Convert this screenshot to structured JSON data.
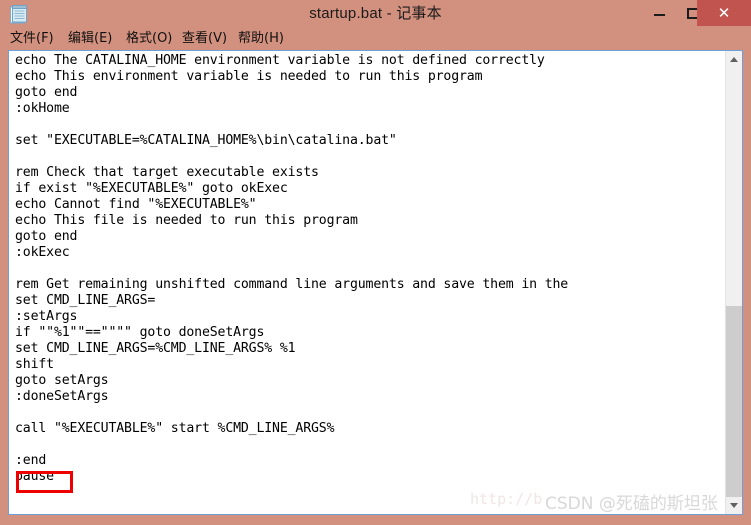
{
  "window": {
    "title": "startup.bat - 记事本",
    "icon": "notepad-icon",
    "frame_color": "#d2907e",
    "close_button_color": "#c25450",
    "controls": {
      "minimize": "−",
      "maximize": "□",
      "close": "✕"
    }
  },
  "menubar": {
    "items": [
      {
        "label": "文件(F)"
      },
      {
        "label": "编辑(E)"
      },
      {
        "label": "格式(O)"
      },
      {
        "label": "查看(V)"
      },
      {
        "label": "帮助(H)"
      }
    ]
  },
  "editor": {
    "content": "echo The CATALINA_HOME environment variable is not defined correctly\necho This environment variable is needed to run this program\ngoto end\n:okHome\n\nset \"EXECUTABLE=%CATALINA_HOME%\\bin\\catalina.bat\"\n\nrem Check that target executable exists\nif exist \"%EXECUTABLE%\" goto okExec\necho Cannot find \"%EXECUTABLE%\"\necho This file is needed to run this program\ngoto end\n:okExec\n\nrem Get remaining unshifted command line arguments and save them in the\nset CMD_LINE_ARGS=\n:setArgs\nif \"\"%1\"\"==\"\"\"\" goto doneSetArgs\nset CMD_LINE_ARGS=%CMD_LINE_ARGS% %1\nshift\ngoto setArgs\n:doneSetArgs\n\ncall \"%EXECUTABLE%\" start %CMD_LINE_ARGS%\n\n:end\npause",
    "lines": [
      "echo The CATALINA_HOME environment variable is not defined correctly",
      "echo This environment variable is needed to run this program",
      "goto end",
      ":okHome",
      "",
      "set \"EXECUTABLE=%CATALINA_HOME%\\bin\\catalina.bat\"",
      "",
      "rem Check that target executable exists",
      "if exist \"%EXECUTABLE%\" goto okExec",
      "echo Cannot find \"%EXECUTABLE%\"",
      "echo This file is needed to run this program",
      "goto end",
      ":okExec",
      "",
      "rem Get remaining unshifted command line arguments and save them in the",
      "set CMD_LINE_ARGS=",
      ":setArgs",
      "if \"\"%1\"\"==\"\"\"\" goto doneSetArgs",
      "set CMD_LINE_ARGS=%CMD_LINE_ARGS% %1",
      "shift",
      "goto setArgs",
      ":doneSetArgs",
      "",
      "call \"%EXECUTABLE%\" start %CMD_LINE_ARGS%",
      "",
      ":end",
      "pause"
    ],
    "highlight": {
      "target_text": "pause",
      "color": "#ee0000"
    }
  },
  "scrollbar": {
    "up_arrow": "▲",
    "down_arrow": "▼",
    "thumb_color": "#cdcdcd",
    "track_color": "#f0f0f0"
  },
  "watermarks": {
    "url": "http://b",
    "csdn": "CSDN @死磕的斯坦张"
  }
}
